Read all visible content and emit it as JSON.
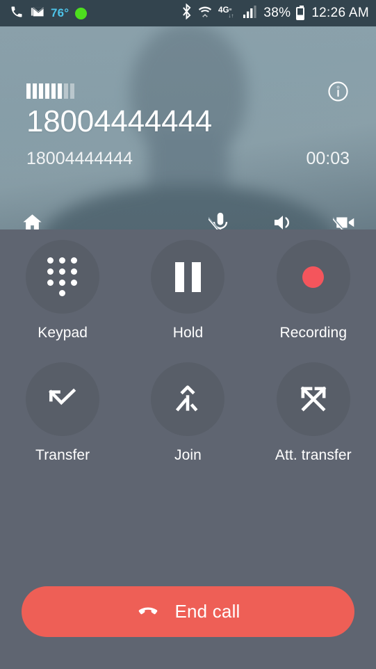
{
  "status_bar": {
    "background_color": "#33444e",
    "left_icons": [
      {
        "name": "phone-icon",
        "label": "Phone"
      },
      {
        "name": "mail-icon",
        "label": "Mail"
      }
    ],
    "temperature": "76°",
    "temperature_color": "#4ec3e8",
    "status_dot_color": "#4ddf1e",
    "right_icons": [
      {
        "name": "bluetooth-icon",
        "label": "Bluetooth"
      },
      {
        "name": "wifi-icon",
        "label": "Wi-Fi"
      },
      {
        "name": "network-4glte-icon",
        "label": "4G LTE"
      },
      {
        "name": "cell-signal-icon",
        "label": "Cellular signal"
      }
    ],
    "battery_percent": "38%",
    "time": "12:26 AM"
  },
  "call_header": {
    "signal_bars_total": 8,
    "signal_bars_active": 6,
    "info_icon_label": "Call info",
    "caller_number": "18004444444",
    "caller_sub_number": "18004444444",
    "call_duration": "00:03",
    "controls": [
      {
        "name": "home-icon",
        "label": "Home",
        "state": "off"
      },
      {
        "name": "mic-muted-icon",
        "label": "Mute",
        "state": "muted"
      },
      {
        "name": "speaker-icon",
        "label": "Speaker",
        "state": "on"
      },
      {
        "name": "video-off-icon",
        "label": "Video",
        "state": "off"
      }
    ]
  },
  "actions": [
    {
      "label": "Keypad",
      "icon": "keypad-icon"
    },
    {
      "label": "Hold",
      "icon": "pause-icon"
    },
    {
      "label": "Recording",
      "icon": "record-icon"
    },
    {
      "label": "Transfer",
      "icon": "call-transfer-icon"
    },
    {
      "label": "Join",
      "icon": "call-merge-icon"
    },
    {
      "label": "Att. transfer",
      "icon": "attended-transfer-icon"
    }
  ],
  "end_call": {
    "label": "End call",
    "icon": "phone-hangup-icon",
    "color": "#ee5f56"
  },
  "theme": {
    "body_background": "#5f6571",
    "circle_background": "#585e68",
    "accent_red": "#f4555c"
  }
}
